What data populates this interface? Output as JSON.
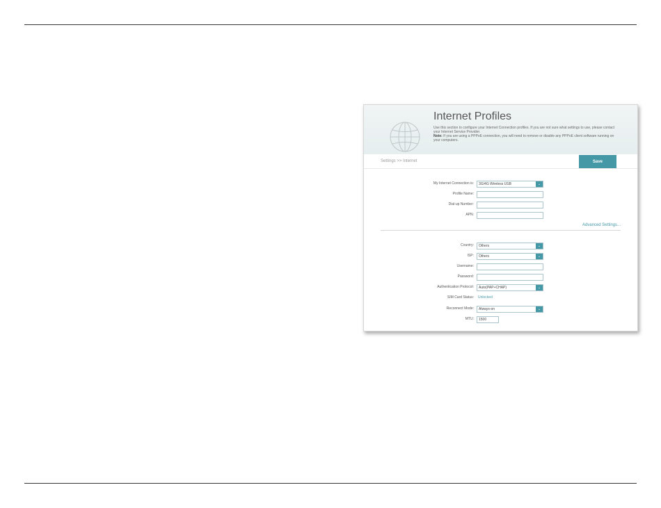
{
  "header": {
    "title": "Internet Profiles",
    "description": "Use this section to configure your Internet Connection profiles. If you are not sure what settings to use, please contact your Internet Service Provider.",
    "note_label": "Note:",
    "note_text": " If you are using a PPPoE connection, you will need to remove or disable any PPPoE client software running on your computers."
  },
  "breadcrumb": "Settings >> Internet",
  "save_label": "Save",
  "connection": {
    "type_label": "My Internet Connection is:",
    "type_value": "3G/4G Wireless USB",
    "profile_name_label": "Profile Name:",
    "profile_name_value": "",
    "dialup_label": "Dial-up Number:",
    "dialup_value": "",
    "apn_label": "APN:",
    "apn_value": ""
  },
  "advanced_settings_label": "Advanced Settings...",
  "advanced": {
    "country_label": "Country:",
    "country_value": "Others",
    "isp_label": "ISP:",
    "isp_value": "Others",
    "username_label": "Username:",
    "username_value": "",
    "password_label": "Password:",
    "password_value": "",
    "auth_label": "Authentication Protocol:",
    "auth_value": "Auto(PAP+CHAP)",
    "sim_label": "SIM Card Status:",
    "sim_value": "Unlocked",
    "reconnect_label": "Reconnect Mode:",
    "reconnect_value": "Always-on",
    "mtu_label": "MTU:",
    "mtu_value": "1500"
  },
  "colors": {
    "accent": "#4598a6",
    "header_bg": "#e9f0f1"
  },
  "icons": {
    "globe": "globe-icon",
    "dropdown": "chevron-down-icon"
  }
}
